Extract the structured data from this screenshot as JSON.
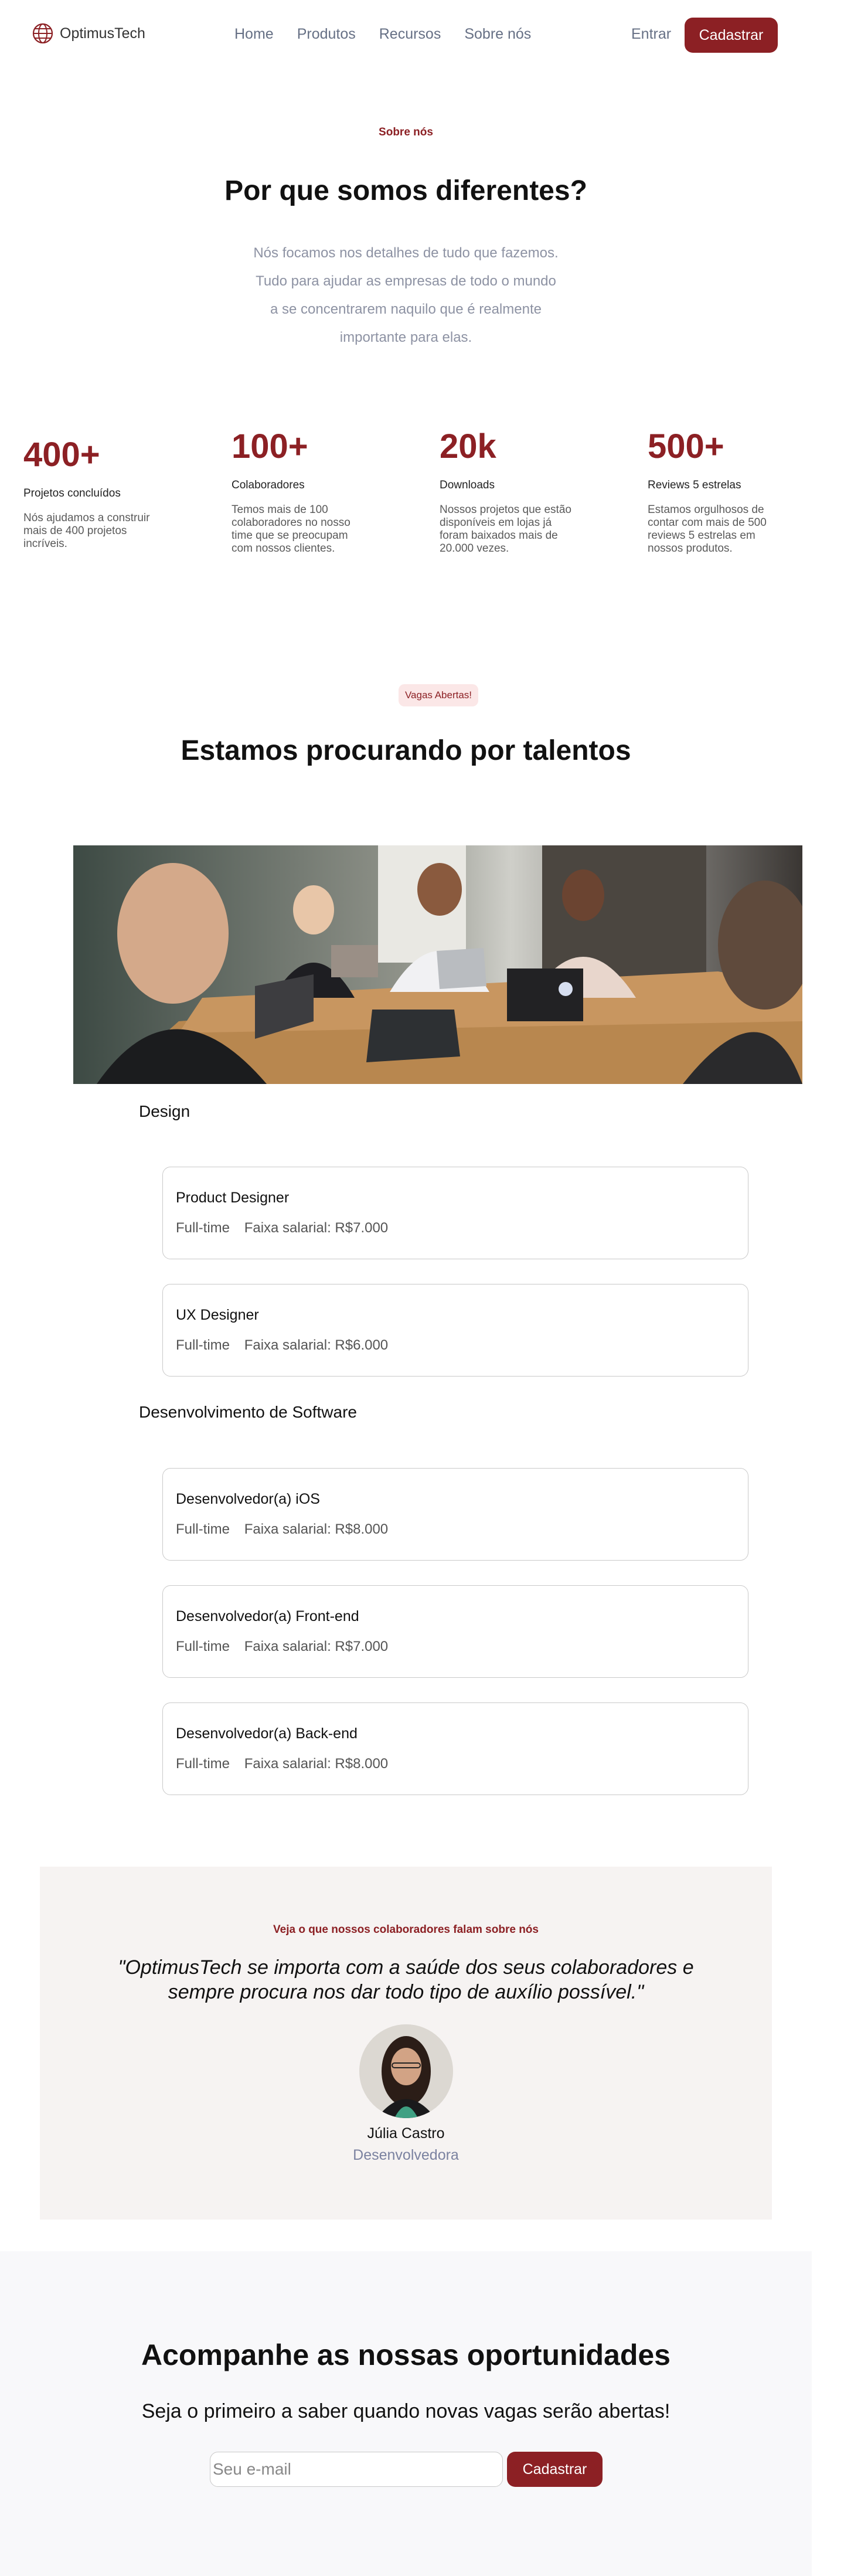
{
  "header": {
    "brand": "OptimusTech",
    "nav": [
      "Home",
      "Produtos",
      "Recursos",
      "Sobre nós"
    ],
    "login": "Entrar",
    "signup": "Cadastrar"
  },
  "about": {
    "eyebrow": "Sobre nós",
    "title": "Por que somos diferentes?",
    "description": "Nós focamos nos detalhes de tudo que fazemos. Tudo para ajudar as empresas de todo o mundo a se concentrarem naquilo que é realmente importante para elas."
  },
  "stats": [
    {
      "number": "400+",
      "label": "Projetos concluídos",
      "desc": "Nós ajudamos a construir mais de 400 projetos incríveis."
    },
    {
      "number": "100+",
      "label": "Colaboradores",
      "desc": "Temos mais de 100 colaboradores no nosso time que se preocupam com nossos clientes."
    },
    {
      "number": "20k",
      "label": "Downloads",
      "desc": "Nossos projetos que estão disponíveis em lojas já foram baixados mais de 20.000 vezes."
    },
    {
      "number": "500+",
      "label": "Reviews 5 estrelas",
      "desc": "Estamos orgulhosos de contar com mais de 500 reviews 5 estrelas em nossos produtos."
    }
  ],
  "jobs": {
    "pill": "Vagas Abertas!",
    "title": "Estamos procurando por talentos",
    "categories": [
      {
        "name": "Design",
        "items": [
          {
            "title": "Product Designer",
            "type": "Full-time",
            "salary": "Faixa salarial: R$7.000"
          },
          {
            "title": "UX Designer",
            "type": "Full-time",
            "salary": "Faixa salarial: R$6.000"
          }
        ]
      },
      {
        "name": "Desenvolvimento de Software",
        "items": [
          {
            "title": "Desenvolvedor(a) iOS",
            "type": "Full-time",
            "salary": "Faixa salarial: R$8.000"
          },
          {
            "title": "Desenvolvedor(a) Front-end",
            "type": "Full-time",
            "salary": "Faixa salarial: R$7.000"
          },
          {
            "title": "Desenvolvedor(a) Back-end",
            "type": "Full-time",
            "salary": "Faixa salarial: R$8.000"
          }
        ]
      }
    ]
  },
  "testimonial": {
    "eyebrow": "Veja o que nossos colaboradores falam sobre nós",
    "quote": "\"OptimusTech se importa com a saúde dos seus colaboradores e sempre procura nos dar todo tipo de auxílio possível.\"",
    "name": "Júlia Castro",
    "role": "Desenvolvedora"
  },
  "newsletter": {
    "title": "Acompanhe as nossas oportunidades",
    "subtitle": "Seja o primeiro a saber quando novas vagas serão abertas!",
    "email_placeholder": "Seu e-mail",
    "button": "Cadastrar"
  },
  "colors": {
    "accent": "#8c2024",
    "muted": "#8d92a3",
    "testimonial_bg": "#f6f3f2",
    "newsletter_bg": "#f8f8fa"
  },
  "icons": {
    "logo": "globe-icon"
  }
}
